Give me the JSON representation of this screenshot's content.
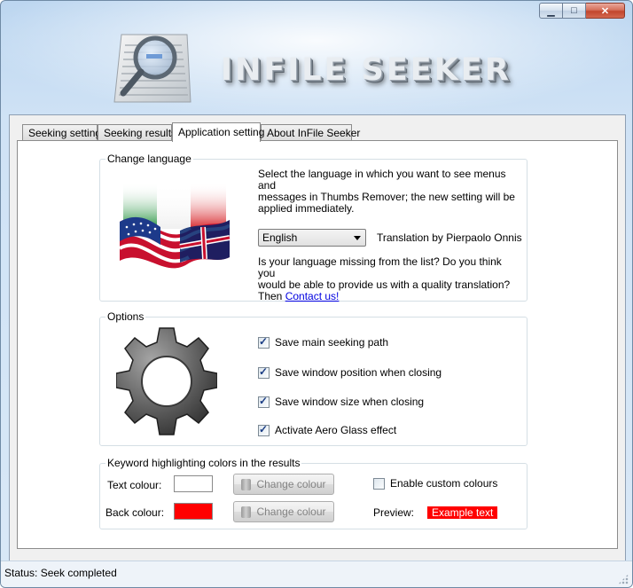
{
  "window": {
    "title_text": "INFILE SEEKER",
    "controls": {
      "minimize": "▁",
      "maximize": "□",
      "close": "✕"
    }
  },
  "tabs": [
    {
      "label": "Seeking setting",
      "active": false
    },
    {
      "label": "Seeking results",
      "active": false
    },
    {
      "label": "Application setting",
      "active": true
    },
    {
      "label": "About InFile Seeker",
      "active": false
    }
  ],
  "language_group": {
    "title": "Change language",
    "description_lines": [
      "Select the language in which you want to see menus and",
      "messages in Thumbs Remover; the new setting will be",
      "applied immediately."
    ],
    "selected_language": "English",
    "translation_credit": "Translation by Pierpaolo Onnis",
    "missing_lines": [
      "Is your language missing from the list? Do you think you",
      "would be able to provide us with a quality translation?"
    ],
    "then_text": "Then ",
    "contact_link": "Contact us!"
  },
  "options_group": {
    "title": "Options",
    "items": [
      {
        "label": "Save main seeking path",
        "checked": true
      },
      {
        "label": "Save window position when closing",
        "checked": true
      },
      {
        "label": "Save window size when closing",
        "checked": true
      },
      {
        "label": "Activate Aero Glass effect",
        "checked": true
      }
    ]
  },
  "colors_group": {
    "title": "Keyword highlighting colors in the results",
    "text_colour_label": "Text colour:",
    "back_colour_label": "Back colour:",
    "change_colour_label": "Change colour",
    "enable_custom_label": "Enable custom colours",
    "enable_custom_checked": false,
    "preview_label": "Preview:",
    "example_text": "Example text",
    "text_colour_value": "#ffffff",
    "back_colour_value": "#ff0000"
  },
  "status": {
    "text": "Status: Seek completed"
  }
}
